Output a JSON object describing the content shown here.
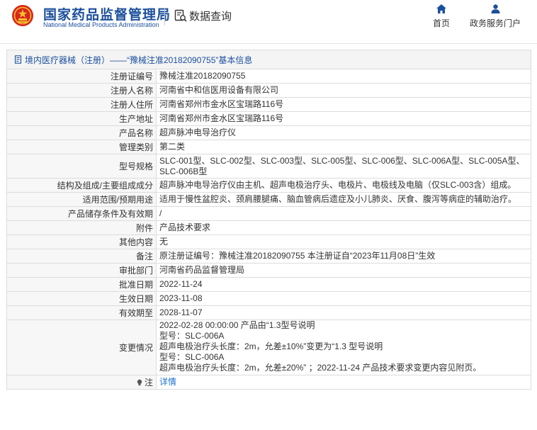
{
  "header": {
    "brand_cn": "国家药品监督管理局",
    "brand_en": "National Medical Products Administration",
    "section_title": "数据查询",
    "nav": [
      {
        "label": "首页",
        "icon": "home-icon"
      },
      {
        "label": "政务服务门户",
        "icon": "user-icon"
      }
    ]
  },
  "breadcrumb": {
    "text": "境内医疗器械（注册）——“豫械注准20182090755”基本信息"
  },
  "rows": [
    {
      "label": "注册证编号",
      "value": "豫械注准20182090755"
    },
    {
      "label": "注册人名称",
      "value": "河南省中和信医用设备有限公司"
    },
    {
      "label": "注册人住所",
      "value": "河南省郑州市金水区宝瑞路116号"
    },
    {
      "label": "生产地址",
      "value": "河南省郑州市金水区宝瑞路116号"
    },
    {
      "label": "产品名称",
      "value": "超声脉冲电导治疗仪"
    },
    {
      "label": "管理类别",
      "value": "第二类"
    },
    {
      "label": "型号规格",
      "value": "SLC-001型、SLC-002型、SLC-003型、SLC-005型、SLC-006型、SLC-006A型、SLC-005A型、SLC-006B型"
    },
    {
      "label": "结构及组成/主要组成成分",
      "value": "超声脉冲电导治疗仪由主机、超声电极治疗头、电极片、电极线及电脑（仅SLC-003含）组成。"
    },
    {
      "label": "适用范围/预期用途",
      "value": "适用于慢性盆腔炎、颈肩腰腿痛、脑血管病后遗症及小儿肺炎、厌食、腹泻等病症的辅助治疗。"
    },
    {
      "label": "产品储存条件及有效期",
      "value": "/"
    },
    {
      "label": "附件",
      "value": "产品技术要求"
    },
    {
      "label": "其他内容",
      "value": "无"
    },
    {
      "label": "备注",
      "value": "原注册证编号：豫械注准20182090755 本注册证自“2023年11月08日”生效"
    },
    {
      "label": "审批部门",
      "value": "河南省药品监督管理局"
    },
    {
      "label": "批准日期",
      "value": "2022-11-24"
    },
    {
      "label": "生效日期",
      "value": "2023-11-08"
    },
    {
      "label": "有效期至",
      "value": "2028-11-07"
    }
  ],
  "change": {
    "label": "变更情况",
    "lines": [
      "2022-02-28 00:00:00 产品由“1.3型号说明",
      "型号：SLC-006A",
      "超声电极治疗头长度：2m，允差±10%”变更为“1.3 型号说明",
      "型号：SLC-006A",
      "超声电极治疗头长度：2m，允差±20%” ；2022-11-24 产品技术要求变更内容见附页。"
    ]
  },
  "note": {
    "label": "注",
    "link": "详情"
  },
  "colors": {
    "brand_blue": "#1b4f9c",
    "link_blue": "#1b6fd1",
    "label_bg": "#f7f7f7",
    "border": "#dcdcdc"
  }
}
